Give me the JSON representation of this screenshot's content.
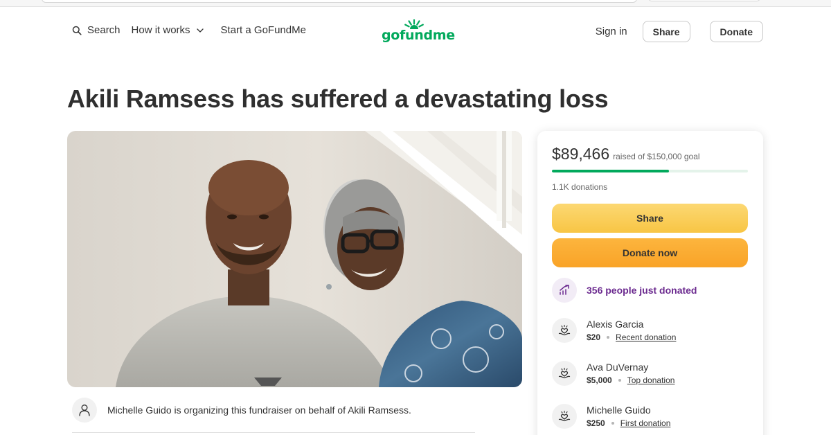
{
  "nav": {
    "search_label": "Search",
    "how_it_works_label": "How it works",
    "start_label": "Start a GoFundMe",
    "logo_text": "gofundme",
    "sign_in_label": "Sign in",
    "share_label": "Share",
    "donate_label": "Donate"
  },
  "campaign": {
    "title": "Akili Ramsess has suffered a devastating loss",
    "organizer_text": "Michelle Guido is organizing this fundraiser on behalf of Akili Ramsess."
  },
  "card": {
    "raised_amount": "$89,466",
    "raised_goal_text": "raised of $150,000 goal",
    "progress_fraction": 0.596,
    "donations_count": "1.1K donations",
    "share_button": "Share",
    "donate_button": "Donate now",
    "trend_text": "356 people just donated",
    "donors": [
      {
        "name": "Alexis Garcia",
        "amount": "$20",
        "tag": "Recent donation"
      },
      {
        "name": "Ava DuVernay",
        "amount": "$5,000",
        "tag": "Top donation"
      },
      {
        "name": "Michelle Guido",
        "amount": "$250",
        "tag": "First donation"
      }
    ]
  },
  "colors": {
    "brand_green": "#02a95c",
    "share_yellow": "#f8c544",
    "donate_orange": "#f9a327",
    "trend_purple": "#6b2a8f"
  },
  "icons": {
    "search": "search-icon",
    "chevron": "chevron-down-icon",
    "organizer": "user-icon",
    "trend": "trending-up-icon",
    "donor": "donation-hand-heart-icon"
  }
}
